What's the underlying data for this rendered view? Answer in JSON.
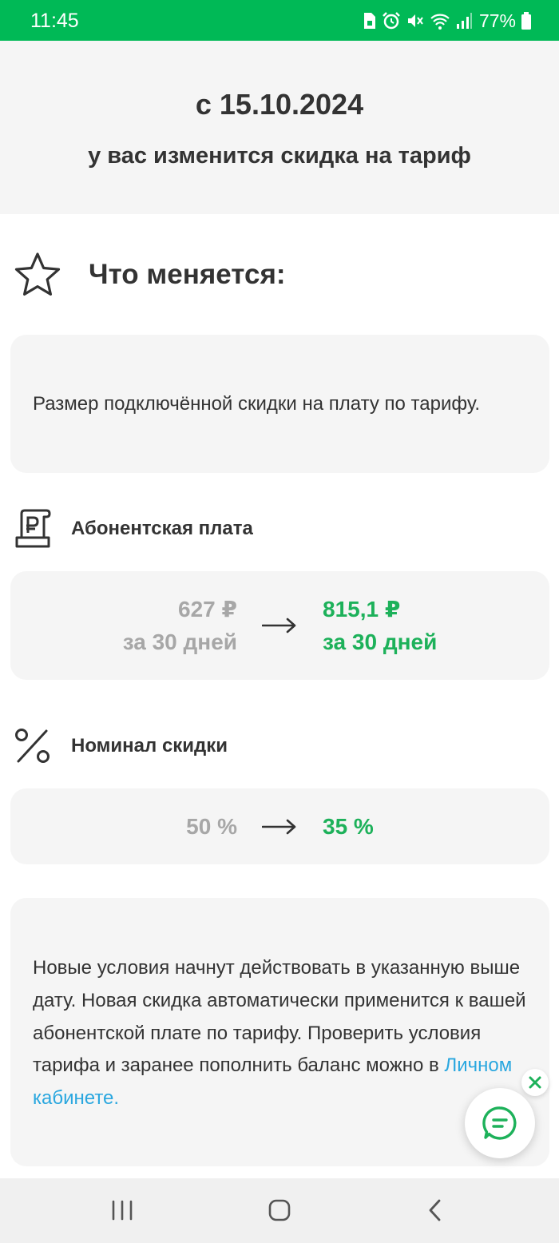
{
  "status_bar": {
    "time": "11:45",
    "battery": "77%",
    "icons": [
      "sim-icon",
      "alarm-icon",
      "mute-icon",
      "wifi-icon",
      "signal-icon",
      "battery-icon"
    ]
  },
  "header": {
    "date": "с 15.10.2024",
    "subtitle": "у вас изменится скидка на тариф"
  },
  "what_changes": {
    "icon": "star-icon",
    "title": "Что меняется:"
  },
  "description": "Размер подключённой скидки на плату по тарифу.",
  "fee": {
    "icon": "receipt-ruble-icon",
    "label": "Абонентская плата",
    "old_price": "627 ₽",
    "old_period": "за 30 дней",
    "new_price": "815,1 ₽",
    "new_period": "за 30 дней"
  },
  "discount": {
    "icon": "percent-icon",
    "label": "Номинал скидки",
    "old_value": "50 %",
    "new_value": "35 %"
  },
  "info": {
    "text_before_link": "Новые условия начнут действовать в указанную выше дату. Новая скидка автоматически применится к вашей абонентской плате по тарифу. Проверить условия тарифа и заранее пополнить баланс можно в ",
    "link_text": "Личном кабинете."
  },
  "colors": {
    "brand_green": "#00b956",
    "accent_green": "#1db15a",
    "old_value_gray": "#a7a7a7",
    "link_blue": "#2aa7df",
    "card_bg": "#f5f5f5"
  },
  "nav": {
    "icons": [
      "recent-apps-icon",
      "home-icon",
      "back-icon"
    ]
  }
}
